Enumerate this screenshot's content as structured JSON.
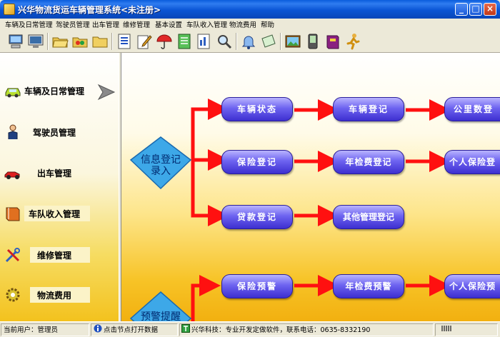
{
  "window": {
    "title": "兴华物流货运车辆管理系统<未注册>",
    "minimize_label": "_",
    "maximize_label": "□",
    "close_label": "×"
  },
  "menu": [
    {
      "label": "车辆及日常管理"
    },
    {
      "label": "驾驶员管理"
    },
    {
      "label": "出车管理"
    },
    {
      "label": "维修管理"
    },
    {
      "label": "基本设置"
    },
    {
      "label": "车队收入管理"
    },
    {
      "label": "物流费用"
    },
    {
      "label": "帮助"
    }
  ],
  "toolbar_icons": [
    "computer-icon",
    "monitor-icon",
    "folder-open-icon",
    "folder-color-icon",
    "folder-icon",
    "list-doc-icon",
    "edit-doc-icon",
    "umbrella-icon",
    "notebook-icon",
    "report-icon",
    "search-doc-icon",
    "tray-icon",
    "bell-icon",
    "note-icon",
    "picture-icon",
    "pda-icon",
    "book-icon",
    "run-icon"
  ],
  "sidebar": {
    "items": [
      {
        "label": "车辆及日常管理",
        "icon": "car-icon"
      },
      {
        "label": "驾驶员管理",
        "icon": "driver-icon"
      },
      {
        "label": "出车管理",
        "icon": "racecar-icon"
      },
      {
        "label": "车队收入管理",
        "icon": "book-icon"
      },
      {
        "label": "维修管理",
        "icon": "tools-icon"
      },
      {
        "label": "物流费用",
        "icon": "gear-icon"
      }
    ]
  },
  "flow": {
    "diamond_1": {
      "line1": "信息登记",
      "line2": "录入"
    },
    "diamond_2": {
      "line1": "预警提醒"
    },
    "row1": [
      "车辆状态",
      "车辆登记",
      "公里数登"
    ],
    "row2": [
      "保险登记",
      "年检费登记",
      "个人保险登"
    ],
    "row3": [
      "贷款登记",
      "其他管理登记"
    ],
    "row4": [
      "保险预警",
      "年检费预警",
      "个人保险预"
    ]
  },
  "status": {
    "user": "当前用户：管理员",
    "hint": "点击节点打开数据",
    "company": "兴华科技：专业开发定做软件，联系电话：0635-8332190"
  },
  "colors": {
    "node_top": "#b9b4ff",
    "node_bottom": "#3d2fd0",
    "arrow": "#ff1010",
    "diamond": "#3da8e8"
  }
}
